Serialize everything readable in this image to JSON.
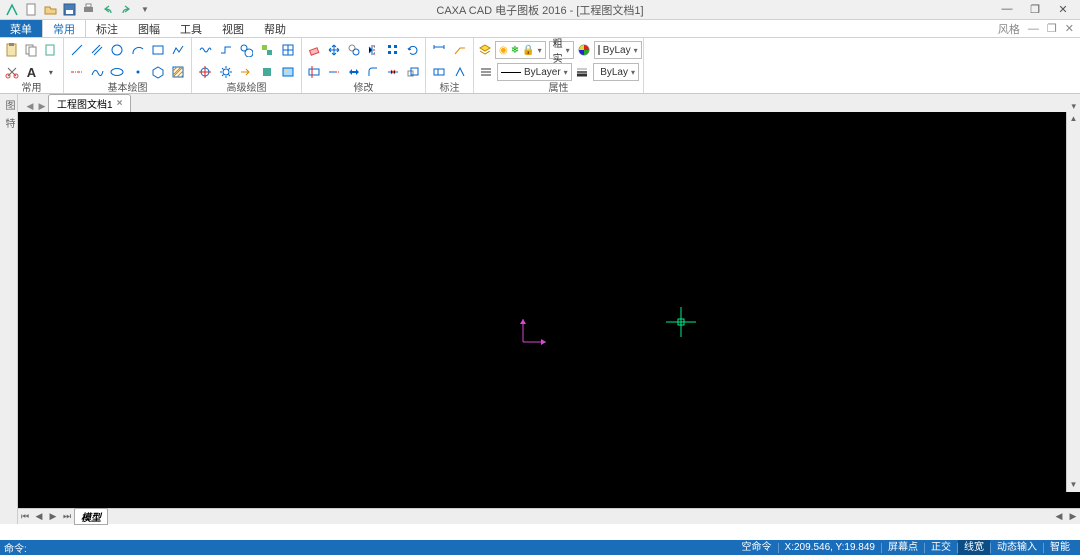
{
  "title": "CAXA CAD 电子图板 2016 - [工程图文档1]",
  "style_label": "风格",
  "menus": {
    "file": "菜单",
    "items": [
      "常用",
      "标注",
      "图幅",
      "工具",
      "视图",
      "帮助"
    ]
  },
  "ribbon": {
    "groups": {
      "common": "常用",
      "basic_draw": "基本绘图",
      "adv_draw": "高级绘图",
      "modify": "修改",
      "annotate": "标注",
      "properties": "属性"
    },
    "dropdowns": {
      "solid": "粗实",
      "bylayer1": "ByLay",
      "bylayer2": "ByLayer",
      "bylayer3": "ByLay"
    }
  },
  "doc_tab": "工程图文档1",
  "model_tab": "模型",
  "status": {
    "cmd": "命令:",
    "empty_cmd": "空命令",
    "coords": "X:209.546, Y:19.849",
    "screen_point": "屏幕点",
    "ortho": "正交",
    "linewidth": "线宽",
    "dyn_input": "动态输入",
    "smart": "智能"
  }
}
